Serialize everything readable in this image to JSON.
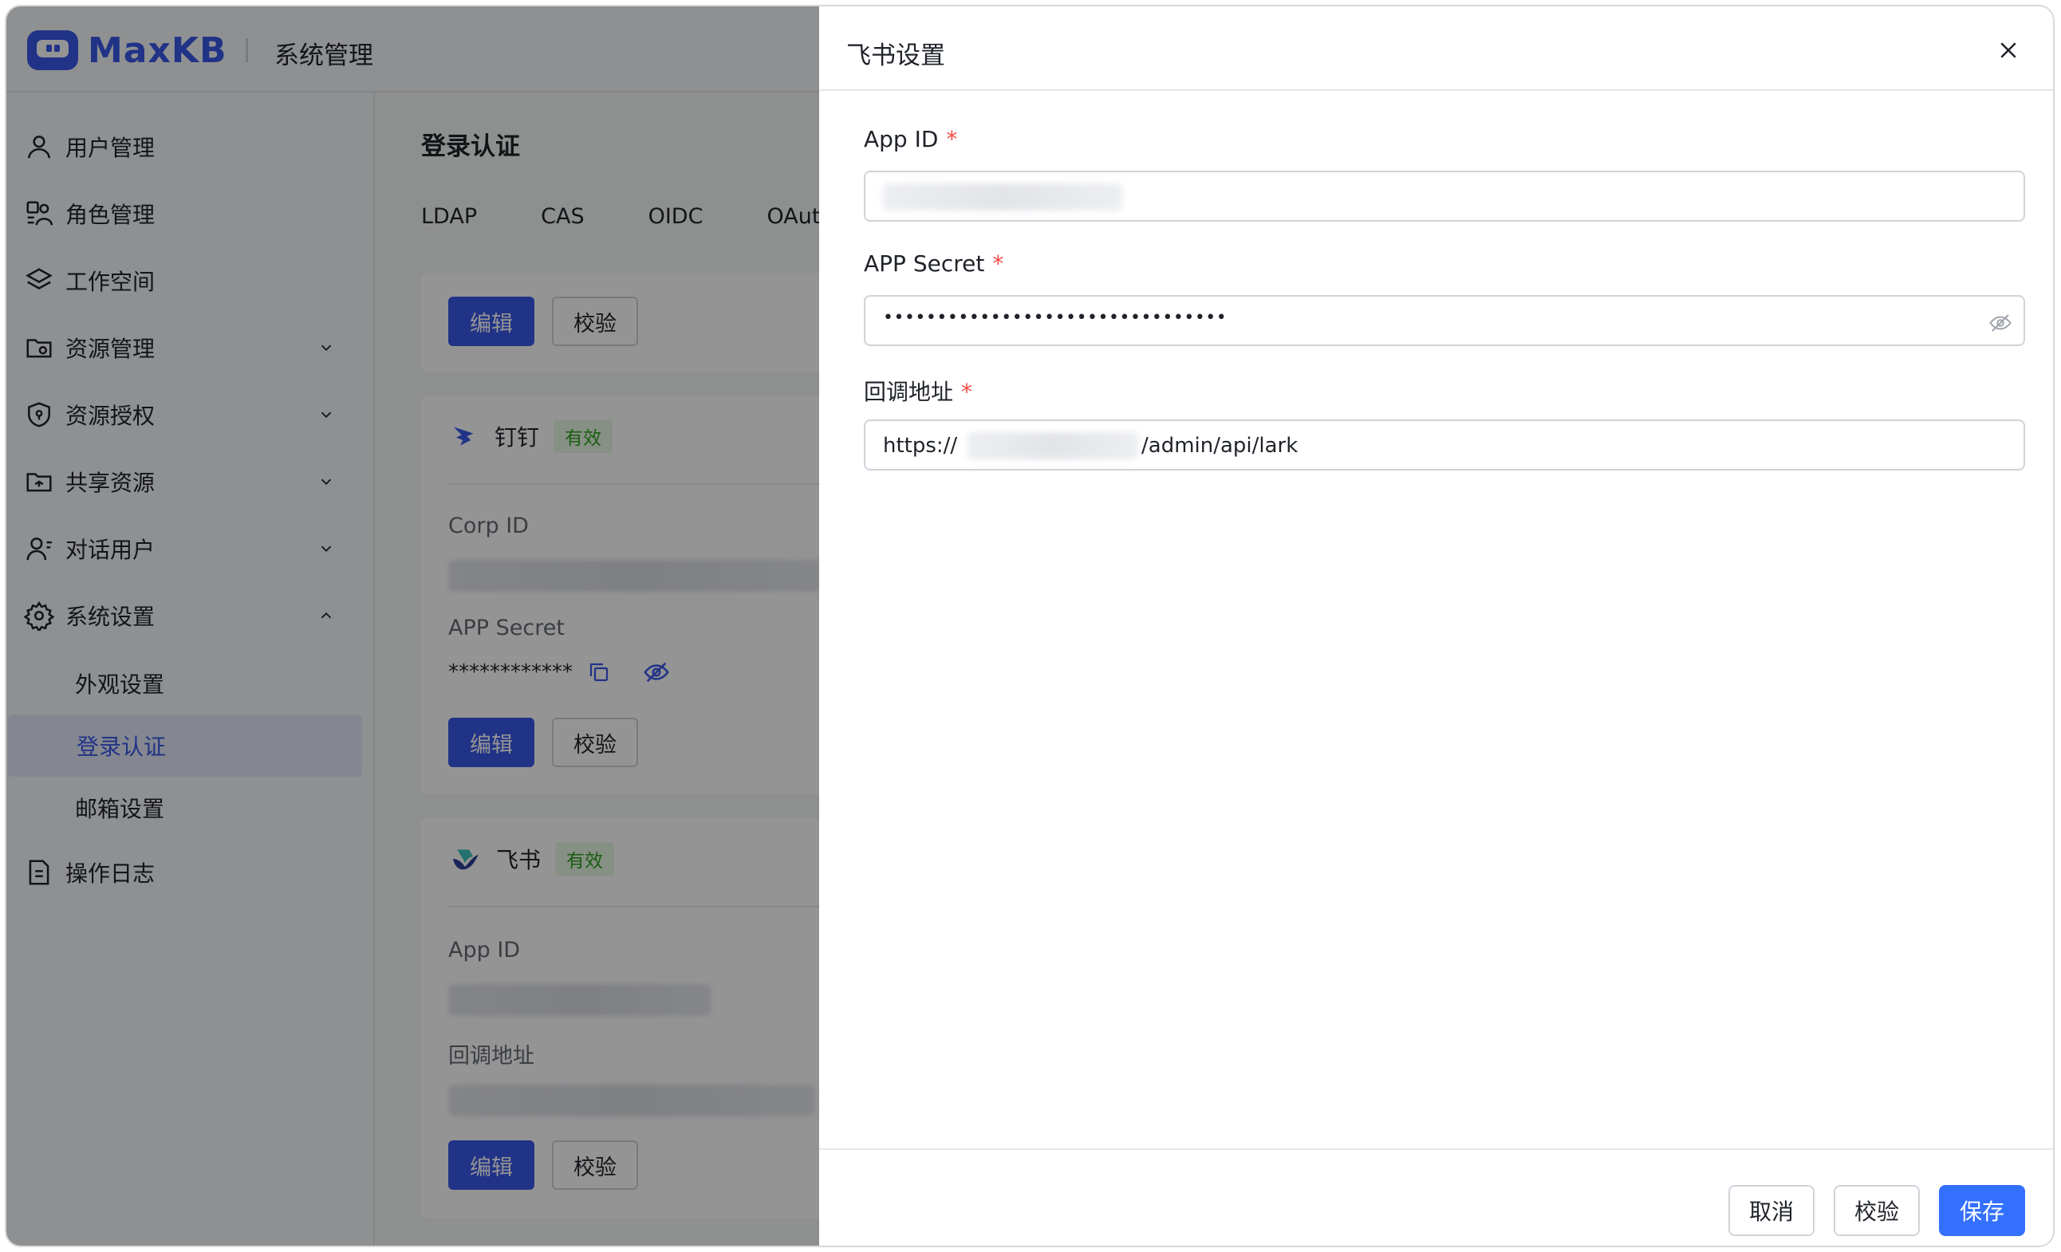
{
  "brand": {
    "name": "MaxKB",
    "color": "#3a58e8"
  },
  "topbar": {
    "title": "系统管理"
  },
  "sidebar": {
    "items": [
      {
        "label": "用户管理",
        "icon": "user-icon"
      },
      {
        "label": "角色管理",
        "icon": "role-icon"
      },
      {
        "label": "工作空间",
        "icon": "layers-icon"
      },
      {
        "label": "资源管理",
        "icon": "folder-gear-icon",
        "expandable": true
      },
      {
        "label": "资源授权",
        "icon": "shield-icon",
        "expandable": true
      },
      {
        "label": "共享资源",
        "icon": "shared-folder-icon",
        "expandable": true
      },
      {
        "label": "对话用户",
        "icon": "chat-user-icon",
        "expandable": true
      },
      {
        "label": "系统设置",
        "icon": "gear-icon",
        "expanded": true
      },
      {
        "label": "操作日志",
        "icon": "document-icon"
      }
    ],
    "sub_items": [
      {
        "label": "外观设置"
      },
      {
        "label": "登录认证",
        "active": true
      },
      {
        "label": "邮箱设置"
      }
    ]
  },
  "main": {
    "title": "登录认证",
    "tabs": [
      "LDAP",
      "CAS",
      "OIDC",
      "OAut"
    ],
    "card1": {
      "edit": "编辑",
      "verify": "校验"
    },
    "dingtalk": {
      "name": "钉钉",
      "status": "有效",
      "corp_id_label": "Corp ID",
      "secret_label": "APP Secret",
      "secret_value": "************",
      "edit": "编辑",
      "verify": "校验"
    },
    "lark": {
      "name": "飞书",
      "status": "有效",
      "app_id_label": "App ID",
      "callback_label": "回调地址",
      "edit": "编辑",
      "verify": "校验"
    }
  },
  "drawer": {
    "title": "飞书设置",
    "fields": {
      "app_id": {
        "label": "App ID",
        "required_mark": "*"
      },
      "app_secret": {
        "label": "APP Secret",
        "required_mark": "*",
        "value": "••••••••••••••••••••••••••••••••"
      },
      "callback": {
        "label": "回调地址",
        "required_mark": "*",
        "value_prefix": "https://",
        "value_suffix": "/admin/api/lark"
      }
    },
    "footer": {
      "cancel": "取消",
      "verify": "校验",
      "save": "保存"
    }
  }
}
